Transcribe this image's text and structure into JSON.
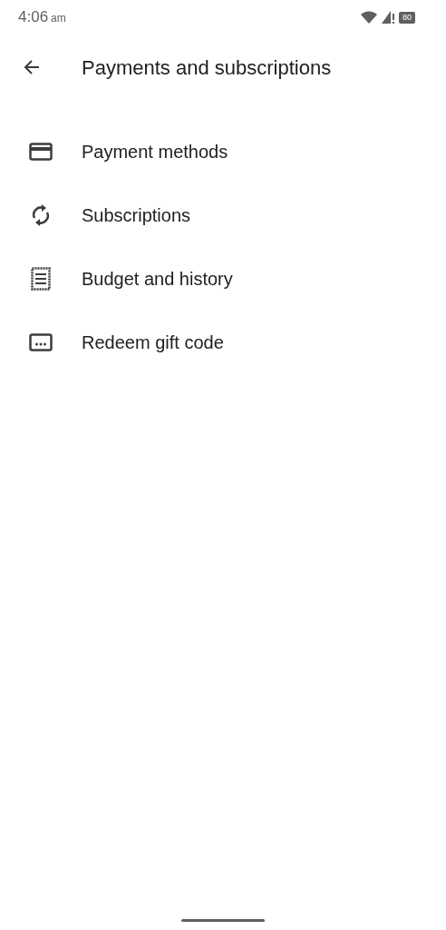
{
  "status_bar": {
    "time": "4:06",
    "period": "am",
    "battery": "80"
  },
  "app_bar": {
    "title": "Payments and subscriptions"
  },
  "items": [
    {
      "kind": "card",
      "label": "Payment methods"
    },
    {
      "kind": "sync",
      "label": "Subscriptions"
    },
    {
      "kind": "receipt",
      "label": "Budget and history"
    },
    {
      "kind": "code",
      "label": "Redeem gift code"
    }
  ]
}
